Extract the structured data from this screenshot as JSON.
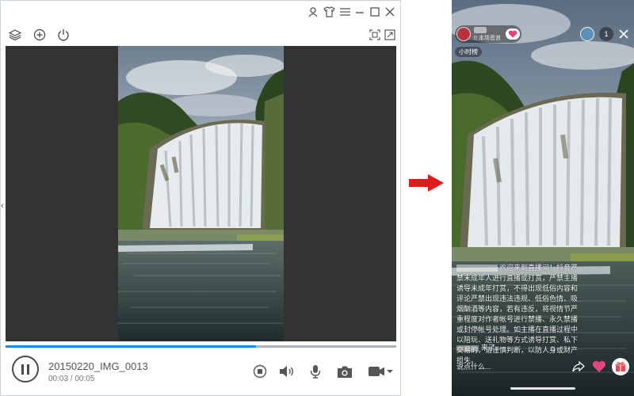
{
  "player": {
    "file_name": "20150220_IMG_0013",
    "time": "00:03 / 00:05",
    "progress": 0.64,
    "side_arrow": "‹"
  },
  "phone": {
    "host_subtitle": "0 本场音浪",
    "hour_rank": "小时榜",
    "viewer_count": "1",
    "notice_text": "欢迎来到直播间！抖音严禁未成年人进行直播或打赏，严禁主播诱导未成年打赏，不得出现低俗内容和评论严禁出现违法违规、低俗色情、吸烟酗酒等内容，若有违反，将视情节严重程度对作者帐号进行禁播、永久禁播或封停帐号处理。如主播在直播过程中以陪玩、送礼物等方式诱导打赏、私下交易的，请谨慎判断，以防人身或财产损失。",
    "join_suffix": "来了",
    "comment_placeholder": "说点什么..."
  },
  "colors": {
    "accent": "#1e88e5",
    "arrow": "#e31a1a",
    "stage": "#333333",
    "like": "#e0457b"
  }
}
